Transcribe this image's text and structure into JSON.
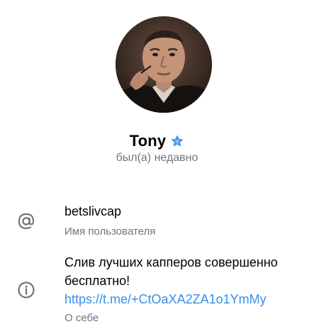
{
  "profile": {
    "name": "Tony",
    "verified_icon": "star-badge-icon",
    "status": "был(а) недавно",
    "accent_color": "#3390ec"
  },
  "username": {
    "icon": "at-sign-icon",
    "value": "betslivcap",
    "caption": "Имя пользователя"
  },
  "about": {
    "icon": "info-circle-icon",
    "text": "Слив лучших капперов совершенно бесплатно!",
    "link": "https://t.me/+CtOaXA2ZA1o1YmMy",
    "caption": "О себе"
  }
}
